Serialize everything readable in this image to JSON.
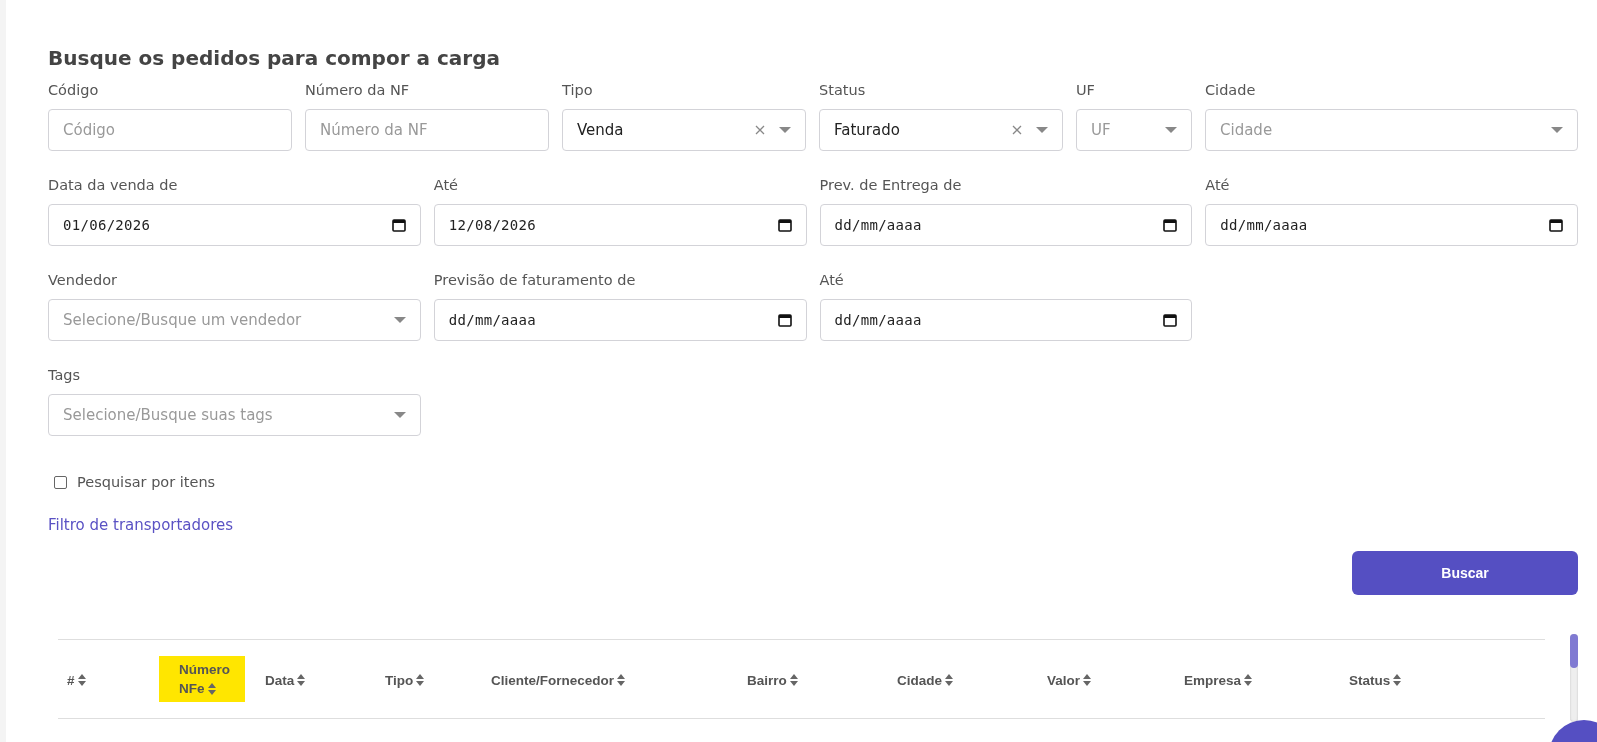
{
  "title": "Busque os pedidos para compor a carga",
  "filter_rows": [
    [
      {
        "kind": "text",
        "label": "Código",
        "placeholder": "Código"
      },
      {
        "kind": "text",
        "label": "Número da NF",
        "placeholder": "Número da NF"
      },
      {
        "kind": "select",
        "label": "Tipo",
        "value": "Venda",
        "clearable": true
      },
      {
        "kind": "select",
        "label": "Status",
        "value": "Faturado",
        "clearable": true
      },
      {
        "kind": "select",
        "label": "UF",
        "placeholder": "UF",
        "clearable": false
      },
      {
        "kind": "select",
        "label": "Cidade",
        "placeholder": "Cidade",
        "clearable": false
      }
    ],
    [
      {
        "kind": "date",
        "label": "Data da venda de",
        "value": "01/06/2026"
      },
      {
        "kind": "date",
        "label": "Até",
        "value": "12/08/2026"
      },
      {
        "kind": "date",
        "label": "Prev. de Entrega de",
        "placeholder": "dd/mm/aaaa"
      },
      {
        "kind": "date",
        "label": "Até",
        "placeholder": "dd/mm/aaaa"
      }
    ],
    [
      {
        "kind": "select",
        "label": "Vendedor",
        "placeholder": "Selecione/Busque um vendedor",
        "clearable": false
      },
      {
        "kind": "date",
        "label": "Previsão de faturamento de",
        "placeholder": "dd/mm/aaaa"
      },
      {
        "kind": "date",
        "label": "Até",
        "placeholder": "dd/mm/aaaa"
      }
    ],
    [
      {
        "kind": "select",
        "label": "Tags",
        "placeholder": "Selecione/Busque suas tags",
        "clearable": false
      }
    ]
  ],
  "search_by_items": {
    "label": "Pesquisar por itens",
    "checked": false
  },
  "carrier_filter_link": "Filtro de transportadores",
  "search_button": "Buscar",
  "table": {
    "columns": [
      {
        "label": "#",
        "highlighted": false
      },
      {
        "label": "Número NFe",
        "highlighted": true
      },
      {
        "label": "Data",
        "highlighted": false
      },
      {
        "label": "Tipo",
        "highlighted": false
      },
      {
        "label": "Cliente/Fornecedor",
        "highlighted": false
      },
      {
        "label": "Bairro",
        "highlighted": false
      },
      {
        "label": "Cidade",
        "highlighted": false
      },
      {
        "label": "Valor",
        "highlighted": false
      },
      {
        "label": "Empresa",
        "highlighted": false
      },
      {
        "label": "Status",
        "highlighted": false
      }
    ]
  }
}
